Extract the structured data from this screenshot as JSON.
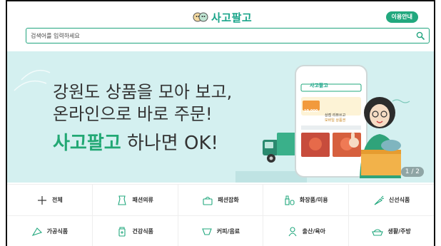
{
  "header": {
    "logo_text": "사고팔고",
    "guide_label": "이용안내"
  },
  "search": {
    "placeholder": "검색어를 입력하세요"
  },
  "banner": {
    "headline_line1": "강원도 상품을 모아 보고,",
    "headline_line2": "온라인으로 바로 주문!",
    "slogan_brand": "사고팔고",
    "slogan_rest": " 하나면 OK!",
    "pager": "1 / 2",
    "phone": {
      "logo_text": "사고팔고",
      "promo_title": "상점 리뷰쓰고",
      "promo_sub": "모바일 상품권",
      "price_badge": "10,000"
    }
  },
  "categories": {
    "row1": [
      {
        "label": "전체",
        "icon": "plus-icon"
      },
      {
        "label": "패션의류",
        "icon": "clothing-icon"
      },
      {
        "label": "패션잡화",
        "icon": "bag-icon"
      },
      {
        "label": "화장품/미용",
        "icon": "cosmetics-icon"
      },
      {
        "label": "신선식품",
        "icon": "carrot-icon"
      }
    ],
    "row2": [
      {
        "label": "가공식품",
        "icon": "processed-food-icon"
      },
      {
        "label": "건강식품",
        "icon": "health-food-icon"
      },
      {
        "label": "커피/음료",
        "icon": "coffee-icon"
      },
      {
        "label": "출산/육아",
        "icon": "baby-icon"
      },
      {
        "label": "생활/주방",
        "icon": "kitchen-icon"
      }
    ]
  },
  "colors": {
    "accent": "#22a87e",
    "banner_bg": "#d4f0f0",
    "brand_text": "#22a874"
  }
}
